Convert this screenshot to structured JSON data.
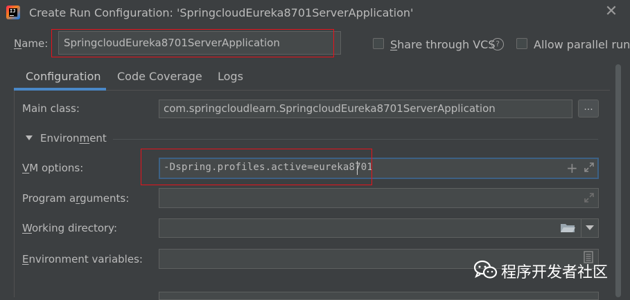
{
  "window": {
    "title": "Create Run Configuration: 'SpringcloudEureka8701ServerApplication'"
  },
  "name_row": {
    "label_underlined": "N",
    "label_rest": "ame:",
    "value": "SpringcloudEureka8701ServerApplication",
    "share_vcs_label_underlined": "S",
    "share_vcs_label_rest": "hare through VCS",
    "share_vcs_checked": false,
    "allow_parallel_label": "Allow parallel run",
    "allow_parallel_checked": false
  },
  "tabs": [
    {
      "label": "Configuration",
      "active": true
    },
    {
      "label": "Code Coverage",
      "active": false
    },
    {
      "label": "Logs",
      "active": false
    }
  ],
  "main_class": {
    "label": "Main class:",
    "value": "com.springcloudlearn.SpringcloudEureka8701ServerApplication",
    "browse_label": "..."
  },
  "environment_section": {
    "label_before": "Environ",
    "label_underlined": "m",
    "label_after": "ent"
  },
  "vm_options": {
    "label_underlined": "V",
    "label_rest": "M options:",
    "value": "-Dspring.profiles.active=eureka8701"
  },
  "program_arguments": {
    "label_before": "Program a",
    "label_underlined": "r",
    "label_after": "guments:",
    "value": ""
  },
  "working_directory": {
    "label_underlined": "W",
    "label_rest": "orking directory:",
    "value": ""
  },
  "environment_variables": {
    "label_underlined": "E",
    "label_rest": "nvironment variables:",
    "value": ""
  },
  "watermark": {
    "text": "程序开发者社区"
  },
  "colors": {
    "background": "#3c3f41",
    "field_bg": "#45494a",
    "tab_accent": "#4a88c7",
    "focus_border": "#3d6185",
    "highlight_red": "#e8121b"
  }
}
